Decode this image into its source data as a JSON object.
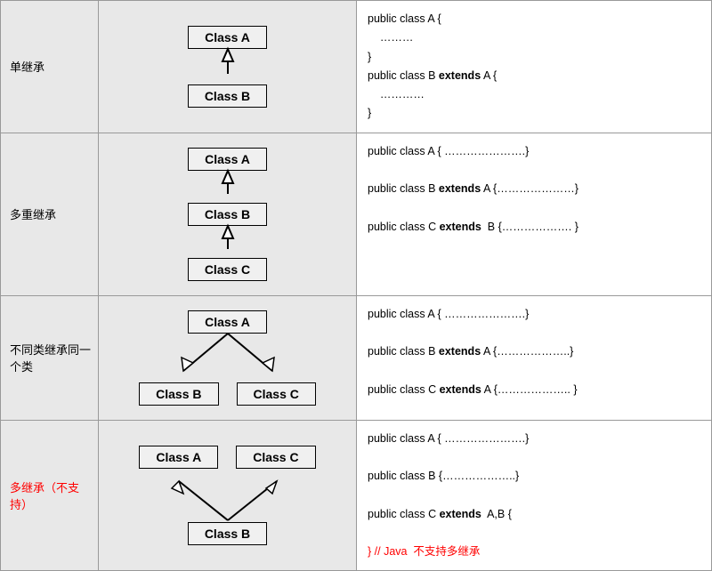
{
  "rows": [
    {
      "id": "single-inheritance",
      "label": "单继承",
      "label_red": false,
      "diagram_type": "single",
      "code_lines": [
        {
          "text": "public class A {",
          "bold_parts": []
        },
        {
          "text": "    ………",
          "bold_parts": []
        },
        {
          "text": "}",
          "bold_parts": []
        },
        {
          "text": "public class B extends A {",
          "bold_parts": [
            "extends"
          ]
        },
        {
          "text": "    …………",
          "bold_parts": []
        },
        {
          "text": "}",
          "bold_parts": []
        }
      ]
    },
    {
      "id": "multi-level-inheritance",
      "label": "多重继承",
      "label_red": false,
      "diagram_type": "multilevel",
      "code_lines": [
        {
          "text": "public class A { ………………….}",
          "bold_parts": []
        },
        {
          "text": "",
          "bold_parts": []
        },
        {
          "text": "public class B extends A {…………………}",
          "bold_parts": [
            "extends"
          ]
        },
        {
          "text": "",
          "bold_parts": []
        },
        {
          "text": "public class C extends  B {………………. }",
          "bold_parts": [
            "extends"
          ]
        }
      ]
    },
    {
      "id": "different-inherit-same",
      "label": "不同类继承同一个类",
      "label_red": false,
      "diagram_type": "different",
      "code_lines": [
        {
          "text": "public class A { ………………….}",
          "bold_parts": []
        },
        {
          "text": "",
          "bold_parts": []
        },
        {
          "text": "public class B extends A {………………..}",
          "bold_parts": [
            "extends"
          ]
        },
        {
          "text": "",
          "bold_parts": []
        },
        {
          "text": "public class C extends A {……………….. }",
          "bold_parts": [
            "extends"
          ]
        }
      ]
    },
    {
      "id": "multi-inherit-unsupported",
      "label": "多继承（不支持）",
      "label_red": true,
      "diagram_type": "multi-unsupported",
      "code_lines": [
        {
          "text": "public class A { ………………….}",
          "bold_parts": []
        },
        {
          "text": "",
          "bold_parts": []
        },
        {
          "text": "public class B {………………..}",
          "bold_parts": []
        },
        {
          "text": "",
          "bold_parts": []
        },
        {
          "text": "public class C extends  A,B {",
          "bold_parts": [
            "extends"
          ]
        },
        {
          "text": "",
          "bold_parts": []
        },
        {
          "text": "} // Java  不支持多继承",
          "bold_parts": [],
          "red": true
        }
      ]
    }
  ]
}
